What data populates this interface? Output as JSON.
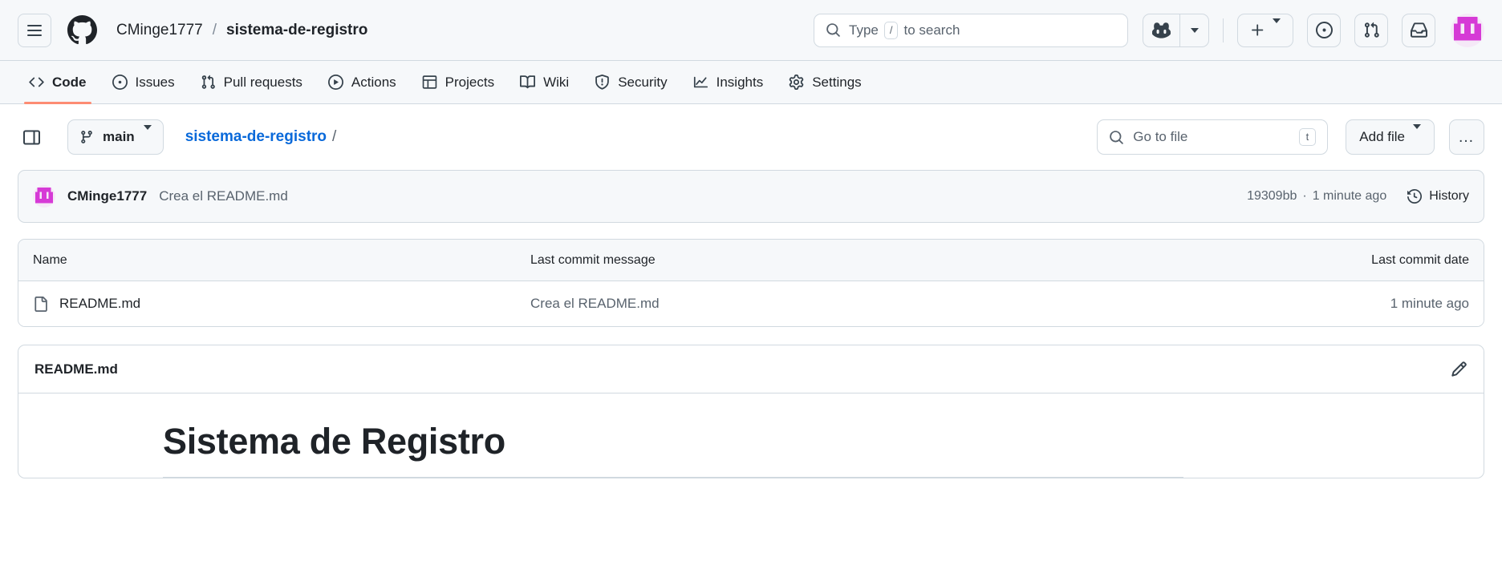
{
  "header": {
    "menu_icon": "hamburger-menu-icon",
    "logo_icon": "github-mark-icon",
    "owner": "CMinge1777",
    "separator": "/",
    "repo": "sistema-de-registro",
    "search": {
      "icon": "search-icon",
      "placeholder_before": "Type",
      "slash_key": "/",
      "placeholder_after": "to search"
    },
    "copilot": {
      "icon": "copilot-icon",
      "caret_icon": "chevron-down-icon"
    },
    "create_new": {
      "icon": "plus-icon",
      "caret_icon": "chevron-down-icon"
    },
    "issues_icon": "issues-dot-icon",
    "pull_requests_icon": "git-pull-request-icon",
    "inbox_icon": "inbox-bell-icon",
    "avatar": "user-avatar-identicon"
  },
  "nav": {
    "items": [
      {
        "label": "Code",
        "icon": "code-brackets-icon",
        "active": true
      },
      {
        "label": "Issues",
        "icon": "issue-opened-icon",
        "active": false
      },
      {
        "label": "Pull requests",
        "icon": "git-pull-request-icon",
        "active": false
      },
      {
        "label": "Actions",
        "icon": "play-circle-icon",
        "active": false
      },
      {
        "label": "Projects",
        "icon": "table-grid-icon",
        "active": false
      },
      {
        "label": "Wiki",
        "icon": "book-icon",
        "active": false
      },
      {
        "label": "Security",
        "icon": "shield-alert-icon",
        "active": false
      },
      {
        "label": "Insights",
        "icon": "graph-line-icon",
        "active": false
      },
      {
        "label": "Settings",
        "icon": "gear-icon",
        "active": false
      }
    ]
  },
  "filebar": {
    "sidebar_toggle_icon": "side-panel-expand-icon",
    "branch": {
      "icon": "git-branch-icon",
      "name": "main",
      "caret_icon": "chevron-down-icon"
    },
    "path": {
      "repo_link": "sistema-de-registro",
      "trailing_slash": "/"
    },
    "go_to_file": {
      "icon": "search-icon",
      "placeholder": "Go to file",
      "shortcut_key": "t"
    },
    "add_file": {
      "label": "Add file",
      "caret_icon": "chevron-down-icon"
    },
    "more_options": {
      "icon": "kebab-horizontal-icon",
      "glyph": "…"
    }
  },
  "commit": {
    "avatar": "author-avatar-identicon",
    "author": "CMinge1777",
    "message": "Crea el README.md",
    "hash": "19309bb",
    "separator": "·",
    "relative_time": "1 minute ago",
    "history": {
      "icon": "history-clock-icon",
      "label": "History"
    }
  },
  "files": {
    "columns": [
      "Name",
      "Last commit message",
      "Last commit date"
    ],
    "rows": [
      {
        "icon": "file-icon",
        "name": "README.md",
        "message": "Crea el README.md",
        "date": "1 minute ago"
      }
    ]
  },
  "readme": {
    "title": "README.md",
    "edit_icon": "pencil-edit-icon",
    "heading": "Sistema de Registro"
  },
  "colors": {
    "accent_blue": "#0969da",
    "active_tab_underline": "#fd8c73",
    "border": "#d1d9e0",
    "surface": "#f6f8fa",
    "muted_text": "#59636e",
    "avatar_magenta": "#d63ad6"
  }
}
